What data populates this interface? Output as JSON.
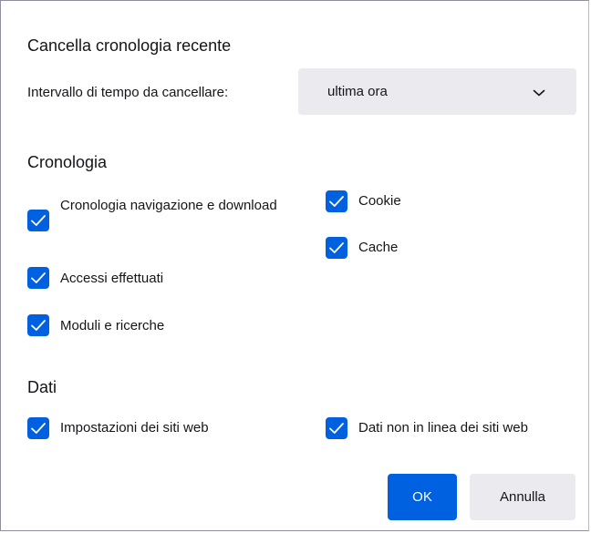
{
  "dialog": {
    "title": "Cancella cronologia recente",
    "range_label": "Intervallo di tempo da cancellare:",
    "range_value": "ultima ora"
  },
  "sections": {
    "history_title": "Cronologia",
    "data_title": "Dati"
  },
  "history_items": {
    "browsing": {
      "label": "Cronologia navigazione e download",
      "checked": true
    },
    "cookies": {
      "label": "Cookie",
      "checked": true
    },
    "cache": {
      "label": "Cache",
      "checked": true
    },
    "logins": {
      "label": "Accessi effettuati",
      "checked": true
    },
    "forms": {
      "label": "Moduli e ricerche",
      "checked": true
    }
  },
  "data_items": {
    "site_settings": {
      "label": "Impostazioni dei siti web",
      "checked": true
    },
    "offline_data": {
      "label": "Dati non in linea dei siti web",
      "checked": true
    }
  },
  "buttons": {
    "ok": "OK",
    "cancel": "Annulla"
  },
  "colors": {
    "accent": "#0061e0",
    "button_bg": "#ebebef",
    "text": "#15141a"
  },
  "icons": {
    "checkbox": "checkmark-icon",
    "dropdown": "chevron-down-icon"
  }
}
